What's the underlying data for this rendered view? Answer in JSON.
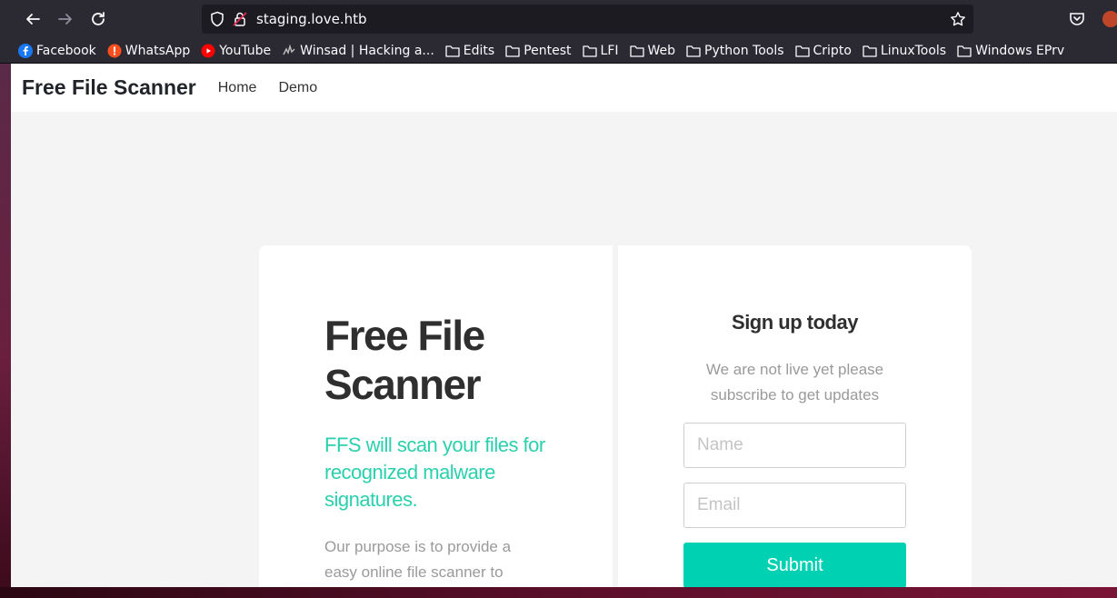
{
  "browser": {
    "url": "staging.love.htb",
    "bookmarks": [
      {
        "label": "Facebook",
        "icon": "facebook-icon"
      },
      {
        "label": "WhatsApp",
        "icon": "whatsapp-icon"
      },
      {
        "label": "YouTube",
        "icon": "youtube-icon"
      },
      {
        "label": "Winsad | Hacking a...",
        "icon": "winsad-icon"
      },
      {
        "label": "Edits",
        "icon": "folder-icon"
      },
      {
        "label": "Pentest",
        "icon": "folder-icon"
      },
      {
        "label": "LFI",
        "icon": "folder-icon"
      },
      {
        "label": "Web",
        "icon": "folder-icon"
      },
      {
        "label": "Python Tools",
        "icon": "folder-icon"
      },
      {
        "label": "Cripto",
        "icon": "folder-icon"
      },
      {
        "label": "LinuxTools",
        "icon": "folder-icon"
      },
      {
        "label": "Windows EPrv",
        "icon": "folder-icon"
      }
    ]
  },
  "site": {
    "brand": "Free File Scanner",
    "nav": [
      "Home",
      "Demo"
    ]
  },
  "hero": {
    "title": "Free File Scanner",
    "subtitle": "FFS will scan your files for recognized malware signatures.",
    "body": "Our purpose is to provide a easy online file scanner to"
  },
  "signup": {
    "title": "Sign up today",
    "text": "We are not live yet please subscribe to get updates",
    "name_placeholder": "Name",
    "email_placeholder": "Email",
    "submit_label": "Submit"
  },
  "colors": {
    "accent": "#00d1b2",
    "subtitle": "#2bd0ad"
  }
}
